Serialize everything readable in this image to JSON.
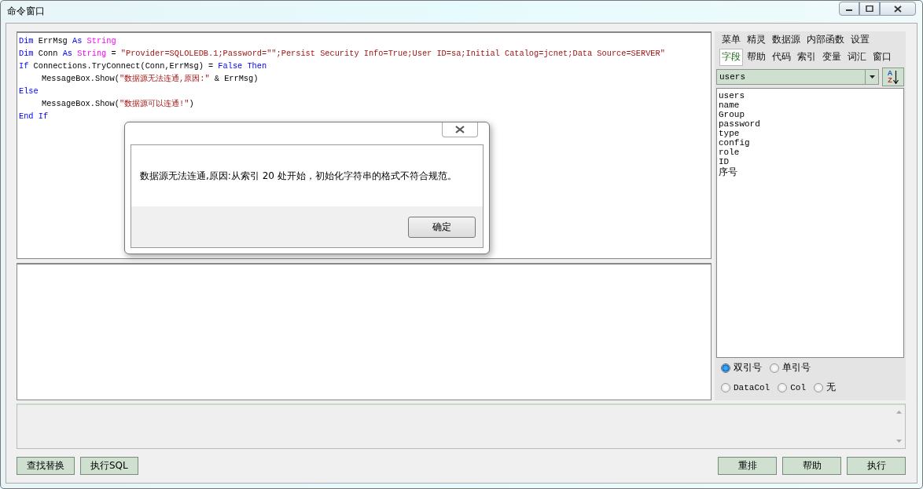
{
  "window": {
    "title": "命令窗口"
  },
  "editor": {
    "lines": [
      {
        "indented": false,
        "tokens": [
          {
            "kind": "keyword",
            "text": "Dim"
          },
          {
            "kind": "plain",
            "text": " ErrMsg "
          },
          {
            "kind": "keyword",
            "text": "As"
          },
          {
            "kind": "type",
            "text": " String"
          }
        ]
      },
      {
        "indented": false,
        "tokens": [
          {
            "kind": "keyword",
            "text": "Dim"
          },
          {
            "kind": "plain",
            "text": " Conn "
          },
          {
            "kind": "keyword",
            "text": "As"
          },
          {
            "kind": "type",
            "text": " String"
          },
          {
            "kind": "plain",
            "text": " = "
          },
          {
            "kind": "string",
            "text": "\"Provider=SQLOLEDB.1;Password=\"\";Persist Security Info=True;User ID=sa;Initial Catalog=jcnet;Data Source=SERVER\""
          }
        ]
      },
      {
        "indented": false,
        "tokens": [
          {
            "kind": "keyword",
            "text": "If"
          },
          {
            "kind": "plain",
            "text": " Connections.TryConnect(Conn,ErrMsg) = "
          },
          {
            "kind": "keyword",
            "text": "False"
          },
          {
            "kind": "keyword",
            "text": " Then"
          }
        ]
      },
      {
        "indented": true,
        "tokens": [
          {
            "kind": "plain",
            "text": "MessageBox.Show("
          },
          {
            "kind": "string",
            "text": "\"数据源无法连通,原因:\""
          },
          {
            "kind": "plain",
            "text": " & ErrMsg)"
          }
        ]
      },
      {
        "indented": false,
        "tokens": [
          {
            "kind": "keyword",
            "text": "Else"
          }
        ]
      },
      {
        "indented": true,
        "tokens": [
          {
            "kind": "plain",
            "text": "MessageBox.Show("
          },
          {
            "kind": "string",
            "text": "\"数据源可以连通!\""
          },
          {
            "kind": "plain",
            "text": ")"
          }
        ]
      },
      {
        "indented": false,
        "tokens": [
          {
            "kind": "keyword",
            "text": "End"
          },
          {
            "kind": "keyword",
            "text": " If"
          }
        ]
      }
    ]
  },
  "side_panel": {
    "tab_rows": [
      [
        {
          "label": "菜单",
          "selected": false
        },
        {
          "label": "精灵",
          "selected": false
        },
        {
          "label": "数据源",
          "selected": false
        },
        {
          "label": "内部函数",
          "selected": false
        },
        {
          "label": "设置",
          "selected": false
        }
      ],
      [
        {
          "label": "字段",
          "selected": true
        },
        {
          "label": "帮助",
          "selected": false
        },
        {
          "label": "代码",
          "selected": false
        },
        {
          "label": "索引",
          "selected": false
        },
        {
          "label": "变量",
          "selected": false
        },
        {
          "label": "词汇",
          "selected": false
        },
        {
          "label": "窗口",
          "selected": false
        }
      ]
    ],
    "table_select": {
      "value": "users"
    },
    "sort_button": {
      "top_letter": "A",
      "bottom_letter": "Z"
    },
    "fields": [
      "users",
      "name",
      "Group",
      "password",
      "type",
      "config",
      "role",
      "ID",
      "序号"
    ],
    "quote_options": [
      {
        "label": "双引号",
        "selected": true
      },
      {
        "label": "单引号",
        "selected": false
      }
    ],
    "column_options": [
      {
        "label": "DataCol",
        "selected": false
      },
      {
        "label": "Col",
        "selected": false
      },
      {
        "label": "无",
        "selected": false
      }
    ]
  },
  "buttons_left": [
    "查找替换",
    "执行SQL"
  ],
  "buttons_right": [
    "重排",
    "帮助",
    "执行"
  ],
  "dialog": {
    "message": "数据源无法连通,原因:从索引 20 处开始，初始化字符串的格式不符合规范。",
    "button": "确定"
  }
}
